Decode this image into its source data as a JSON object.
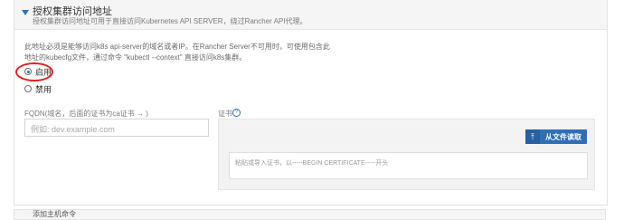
{
  "section": {
    "title": "授权集群访问地址",
    "subtitle": "授权集群访问地址可用于直接访问Kubernetes API SERVER，绕过Rancher API代理。"
  },
  "description": "此地址必须是能够访问k8s api-server的域名或者IP。在Rancher Server不可用时，可使用包含此地址的kubecfg文件，通过命令 \"kubectl --context\" 直接访问k8s集群。",
  "options": {
    "enable_label": "启用",
    "disable_label": "禁用",
    "selected": "启用"
  },
  "fqdn": {
    "label": "FQDN(域名，后面的证书为ca证书 → )",
    "placeholder": "例如: dev.example.com"
  },
  "cert": {
    "label": "证书",
    "read_button": "从文件读取",
    "placeholder": "粘贴或导入证书，以-----BEGIN CERTIFICATE-----开头"
  },
  "next_section": {
    "title": "添加主机命令"
  },
  "colors": {
    "accent": "#2f6fb7",
    "highlight": "#e02020"
  }
}
